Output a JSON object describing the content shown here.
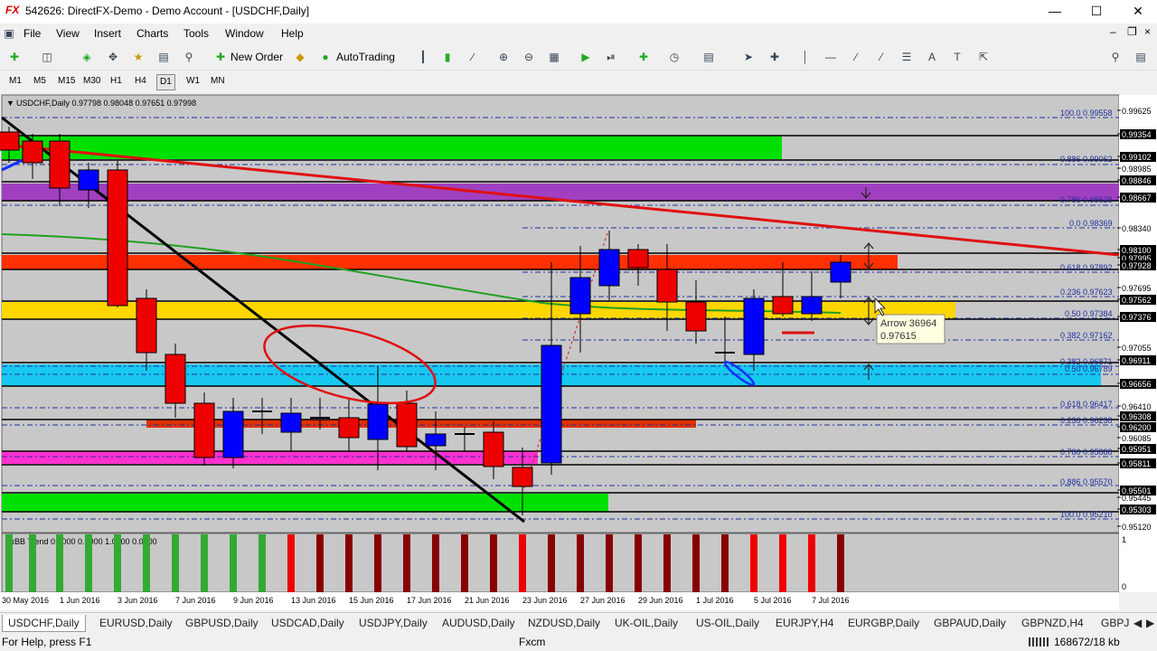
{
  "window": {
    "title": "542626: DirectFX-Demo - Demo Account - [USDCHF,Daily]",
    "app_badge": "FX"
  },
  "menu": [
    "File",
    "View",
    "Insert",
    "Charts",
    "Tools",
    "Window",
    "Help"
  ],
  "toolbar": {
    "new_order": "New Order",
    "auto_trading": "AutoTrading"
  },
  "timeframes": [
    "M1",
    "M5",
    "M15",
    "M30",
    "H1",
    "H4",
    "D1",
    "W1",
    "MN"
  ],
  "active_timeframe": "D1",
  "chart": {
    "header": "USDCHF,Daily  0.97798 0.98048 0.97651 0.97998",
    "indicator_label": "FxBB Trend 0.0000 0.0000 1.0000 0.0000",
    "indicator_scale_top": "1",
    "indicator_scale_bottom": "0",
    "tooltip_line1": "Arrow 36964",
    "tooltip_line2": "0.97615",
    "bg_color": "#c8c8c8",
    "price_axis_labels": [
      "0.99625",
      "0.99354",
      "0.99102",
      "0.98985",
      "0.98846",
      "0.98667",
      "0.98340",
      "0.98100",
      "0.97995",
      "0.97928",
      "0.97695",
      "0.97562",
      "0.97376",
      "0.97055",
      "0.96911",
      "0.96656",
      "0.96410",
      "0.96308",
      "0.96200",
      "0.96085",
      "0.95951",
      "0.95811",
      "0.95501",
      "0.95445",
      "0.95303",
      "0.95120"
    ],
    "fib_labels": [
      "100.0  0.99558",
      "0.886  0.99062",
      "0.786  0.98628",
      "0.0  0.98369",
      "0.618  0.97892",
      "0.236  0.97623",
      "0.50  0.97384",
      "0.382  0.97162",
      "0.382  0.96871",
      "0.50  0.96789",
      "0.618  0.96417",
      "0.236  0.96238",
      "0.786  0.95888",
      "0.886  0.95570",
      "100.0  0.95210"
    ],
    "date_labels": [
      "30 May 2016",
      "1 Jun 2016",
      "3 Jun 2016",
      "7 Jun 2016",
      "9 Jun 2016",
      "13 Jun 2016",
      "15 Jun 2016",
      "17 Jun 2016",
      "21 Jun 2016",
      "23 Jun 2016",
      "27 Jun 2016",
      "29 Jun 2016",
      "1 Jul 2016",
      "5 Jul 2016",
      "7 Jul 2016"
    ]
  },
  "tabs": [
    "USDCHF,Daily",
    "EURUSD,Daily",
    "GBPUSD,Daily",
    "USDCAD,Daily",
    "USDJPY,Daily",
    "AUDUSD,Daily",
    "NZDUSD,Daily",
    "UK-OIL,Daily",
    "US-OIL,Daily",
    "EURJPY,H4",
    "EURGBP,Daily",
    "GBPAUD,Daily",
    "GBPNZD,H4",
    "GBPJ"
  ],
  "status": {
    "help": "For Help, press F1",
    "profile": "Fxcm",
    "traffic": "168672/18 kb"
  }
}
